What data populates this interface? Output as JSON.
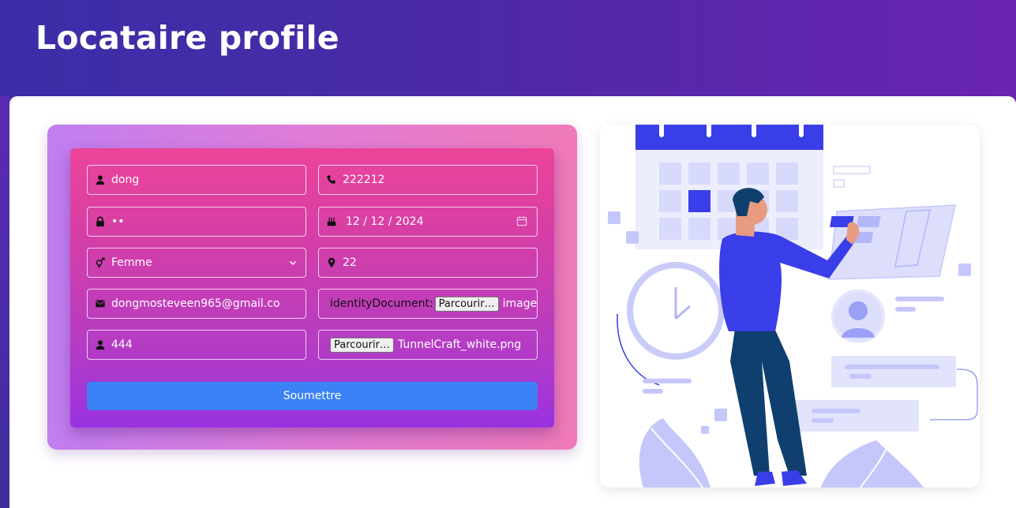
{
  "header": {
    "title": "Locataire profile"
  },
  "form": {
    "username": "dong",
    "phone": "222212",
    "password": "••",
    "birthdate": "12 / 12 / 2024",
    "gender": "Femme",
    "address": "22",
    "email": "dongmosteveen965@gmail.co",
    "identity_label": "identityDocument:",
    "identity_button": "Parcourir…",
    "identity_file": "image_un_taxi_e",
    "extra_field": "444",
    "photo_button": "Parcourir…",
    "photo_file": "TunnelCraft_white.png",
    "submit_label": "Soumettre"
  },
  "icons": {
    "username": "user-icon",
    "phone": "phone-icon",
    "password": "lock-icon",
    "birthdate": "cake-icon",
    "gender": "gender-icon",
    "address": "map-pin-icon",
    "email": "envelope-icon",
    "extra": "user-icon"
  },
  "colors": {
    "header_start": "#3b2ea8",
    "header_end": "#6a22b2",
    "submit": "#3b82f6",
    "illustration_accent": "#3a3ee8"
  }
}
